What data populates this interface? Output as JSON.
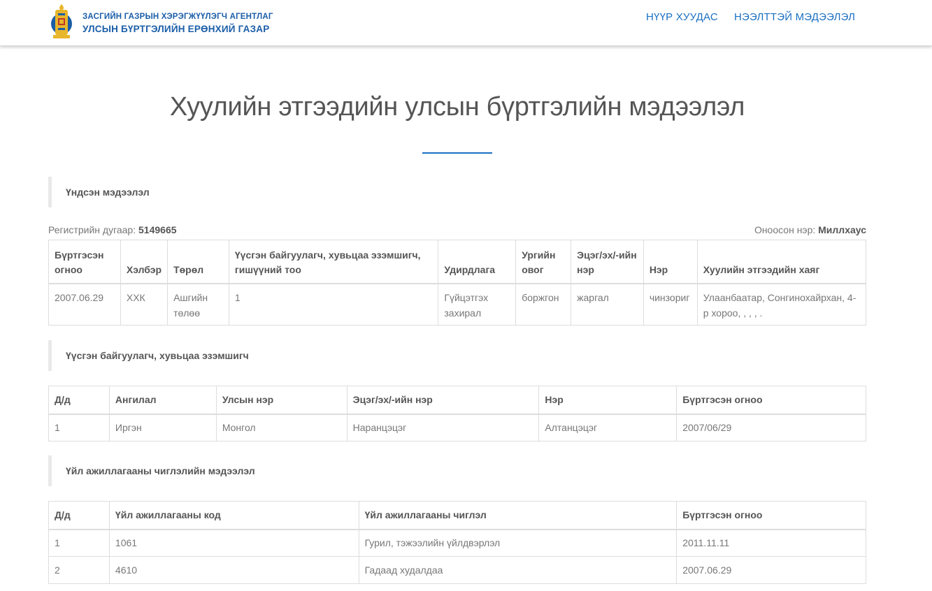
{
  "header": {
    "logo_line1": "ЗАСГИЙН ГАЗРЫН ХЭРЭГЖҮҮЛЭГЧ АГЕНТЛАГ",
    "logo_line2": "УЛСЫН БҮРТГЭЛИЙН ЕРӨНХИЙ ГАЗАР",
    "nav": [
      {
        "label": "НҮҮР ХУУДАС"
      },
      {
        "label": "НЭЭЛТТЭЙ МЭДЭЭЛЭЛ"
      }
    ]
  },
  "page": {
    "title": "Хуулийн этгээдийн улсын бүртгэлийн мэдээлэл"
  },
  "basic": {
    "heading": "Үндсэн мэдээлэл",
    "reg_label": "Регистрийн дугаар:",
    "reg_value": "5149665",
    "name_label": "Оноосон нэр:",
    "name_value": "Миллхаус",
    "columns": [
      "Бүртгэсэн огноо",
      "Хэлбэр",
      "Төрөл",
      "Үүсгэн байгуулагч, хувьцаа эзэмшигч, гишүүний тоо",
      "Удирдлага",
      "Ургийн овог",
      "Эцэг/эх/-ийн нэр",
      "Нэр",
      "Хуулийн этгээдийн хаяг"
    ],
    "rows": [
      [
        "2007.06.29",
        "ХХК",
        "Ашгийн төлөө",
        "1",
        "Гүйцэтгэх захирал",
        "боржгон",
        "жаргал",
        "чинзориг",
        "Улаанбаатар, Сонгинохайрхан, 4-р хороо, , , , ."
      ]
    ]
  },
  "founders": {
    "heading": "Үүсгэн байгуулагч, хувьцаа эзэмшигч",
    "columns": [
      "Д/д",
      "Ангилал",
      "Улсын нэр",
      "Эцэг/эх/-ийн нэр",
      "Нэр",
      "Бүртгэсэн огноо"
    ],
    "rows": [
      [
        "1",
        "Иргэн",
        "Монгол",
        "Наранцэцэг",
        "Алтанцэцэг",
        "2007/06/29"
      ]
    ]
  },
  "activities": {
    "heading": "Үйл ажиллагааны чиглэлийн мэдээлэл",
    "columns": [
      "Д/д",
      "Үйл ажиллагааны код",
      "Үйл ажиллагааны чиглэл",
      "Бүртгэсэн огноо"
    ],
    "rows": [
      [
        "1",
        "1061",
        "Гурил, тэжээлийн үйлдвэрлэл",
        "2011.11.11"
      ],
      [
        "2",
        "4610",
        "Гадаад худалдаа",
        "2007.06.29"
      ]
    ]
  },
  "colors": {
    "brand_blue": "#1b5ea8",
    "link_blue": "#1b6fc2",
    "emblem_gold": "#e8b62c"
  }
}
